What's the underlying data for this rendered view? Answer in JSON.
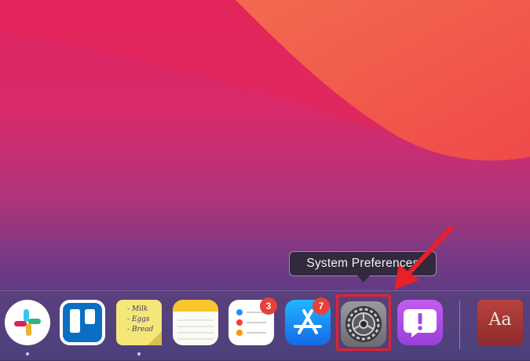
{
  "tooltip": {
    "text": "System Preferences"
  },
  "dock": {
    "apps": [
      {
        "name": "Slack"
      },
      {
        "name": "Trello"
      },
      {
        "name": "Stickies",
        "note_lines": [
          "- Milk",
          "- Eggs",
          "- Bread"
        ]
      },
      {
        "name": "Notes"
      },
      {
        "name": "Reminders",
        "badge": "3"
      },
      {
        "name": "App Store",
        "badge": "7"
      },
      {
        "name": "System Preferences",
        "highlighted": true
      },
      {
        "name": "Feedback Assistant"
      },
      {
        "name": "Dictionary",
        "glyph": "Aa"
      }
    ]
  },
  "colors": {
    "annotation_red": "#e8202a",
    "badge_red": "#e8403a"
  }
}
